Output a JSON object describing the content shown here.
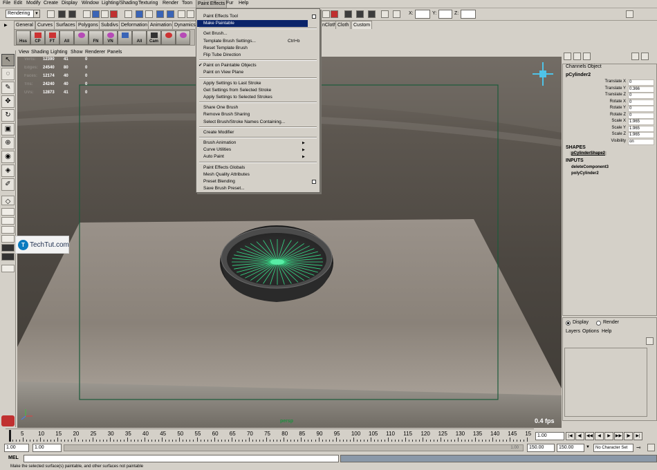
{
  "menubar": {
    "items": [
      "File",
      "Edit",
      "Modify",
      "Create",
      "Display",
      "Window",
      "Lighting/Shading",
      "Texturing",
      "Render",
      "Toon",
      "Paint Effects",
      "Fur",
      "Help"
    ],
    "active": "Paint Effects"
  },
  "statusline": {
    "mode": "Rendering",
    "x_label": "X:",
    "y_label": "Y:",
    "z_label": "Z:"
  },
  "shelf": {
    "tabs": [
      "General",
      "Curves",
      "Surfaces",
      "Polygons",
      "Subdivs",
      "Deformation",
      "Animation",
      "Dynamics",
      "nCloth",
      "Cloth",
      "Custom"
    ],
    "active_tab": "Custom",
    "buttons": [
      "Hss",
      "CP",
      "FT",
      "All",
      "",
      "FN",
      "VN",
      "",
      "All",
      "Cam",
      "",
      ""
    ]
  },
  "view_menu": [
    "View",
    "Shading",
    "Lighting",
    "Show",
    "Renderer",
    "Panels"
  ],
  "hud": {
    "labels": [
      "Verts:",
      "Edges:",
      "Faces:",
      "Tris:",
      "UVs:"
    ],
    "col1": [
      "12390",
      "24540",
      "12174",
      "24240",
      "12873"
    ],
    "col2": [
      "41",
      "80",
      "40",
      "40",
      "41"
    ],
    "col3": [
      "0",
      "0",
      "0",
      "0",
      "0"
    ]
  },
  "viewport": {
    "camera": "persp",
    "fps": "0.4 fps",
    "accent_green": "#1f8f3f",
    "stroke_green": "#36e08a"
  },
  "paint_effects_menu": {
    "items": [
      {
        "label": "Paint Effects Tool",
        "option_box": true
      },
      {
        "label": "Make Paintable",
        "highlighted": true
      },
      {
        "separator": true
      },
      {
        "label": "Get Brush..."
      },
      {
        "label": "Template Brush Settings...",
        "shortcut": "Ctrl+b"
      },
      {
        "label": "Reset Template Brush"
      },
      {
        "label": "Flip Tube Direction"
      },
      {
        "separator": true
      },
      {
        "label": "Paint on Paintable Objects",
        "checked": true
      },
      {
        "label": "Paint on View Plane"
      },
      {
        "separator": true
      },
      {
        "label": "Apply Settings to Last Stroke"
      },
      {
        "label": "Get Settings from Selected Stroke"
      },
      {
        "label": "Apply Settings to Selected Strokes"
      },
      {
        "separator": true
      },
      {
        "label": "Share One Brush"
      },
      {
        "label": "Remove Brush Sharing"
      },
      {
        "label": "Select Brush/Stroke Names Containing..."
      },
      {
        "separator": true
      },
      {
        "label": "Create Modifier"
      },
      {
        "separator": true
      },
      {
        "label": "Brush Animation",
        "submenu": true
      },
      {
        "label": "Curve Utilities",
        "submenu": true
      },
      {
        "label": "Auto Paint",
        "submenu": true
      },
      {
        "separator": true
      },
      {
        "label": "Paint Effects Globals"
      },
      {
        "label": "Mesh Quality Attributes"
      },
      {
        "label": "Preset Blending",
        "option_box": true
      },
      {
        "label": "Save Brush Preset..."
      }
    ],
    "highlight_color": "#0a246a"
  },
  "channel_box": {
    "tabs": "Channels   Object",
    "object": "pCylinder2",
    "attributes": [
      {
        "name": "Translate X",
        "value": "0"
      },
      {
        "name": "Translate Y",
        "value": "0.366"
      },
      {
        "name": "Translate Z",
        "value": "0"
      },
      {
        "name": "Rotate X",
        "value": "0"
      },
      {
        "name": "Rotate Y",
        "value": "0"
      },
      {
        "name": "Rotate Z",
        "value": "0"
      },
      {
        "name": "Scale X",
        "value": "1.965"
      },
      {
        "name": "Scale Y",
        "value": "1.965"
      },
      {
        "name": "Scale Z",
        "value": "1.965"
      },
      {
        "name": "Visibility",
        "value": "on"
      }
    ],
    "shapes_header": "SHAPES",
    "shape": "pCylinderShape2",
    "inputs_header": "INPUTS",
    "inputs": [
      "deleteComponent3",
      "polyCylinder2"
    ]
  },
  "layer_editor": {
    "display": "Display",
    "render": "Render",
    "menus": [
      "Layers",
      "Options",
      "Help"
    ]
  },
  "badge": {
    "logo_letter": "T",
    "text": "TechTut.com"
  },
  "timeslider": {
    "ticks": [
      "5",
      "10",
      "15",
      "20",
      "25",
      "30",
      "35",
      "40",
      "45",
      "50",
      "55",
      "60",
      "65",
      "70",
      "75",
      "80",
      "85",
      "90",
      "95",
      "100",
      "105",
      "110",
      "115",
      "120",
      "125",
      "130",
      "135",
      "140",
      "145",
      "15"
    ],
    "current": "1.00"
  },
  "range": {
    "start": "1.00",
    "inner_start": "1.00",
    "inner_end": "150.00",
    "end": "150.00",
    "handle_label": "1.00",
    "character_set": "No Character Set"
  },
  "cmdline": {
    "label": "MEL",
    "help": "Make the selected surface(s) paintable, and other surfaces not paintable"
  }
}
